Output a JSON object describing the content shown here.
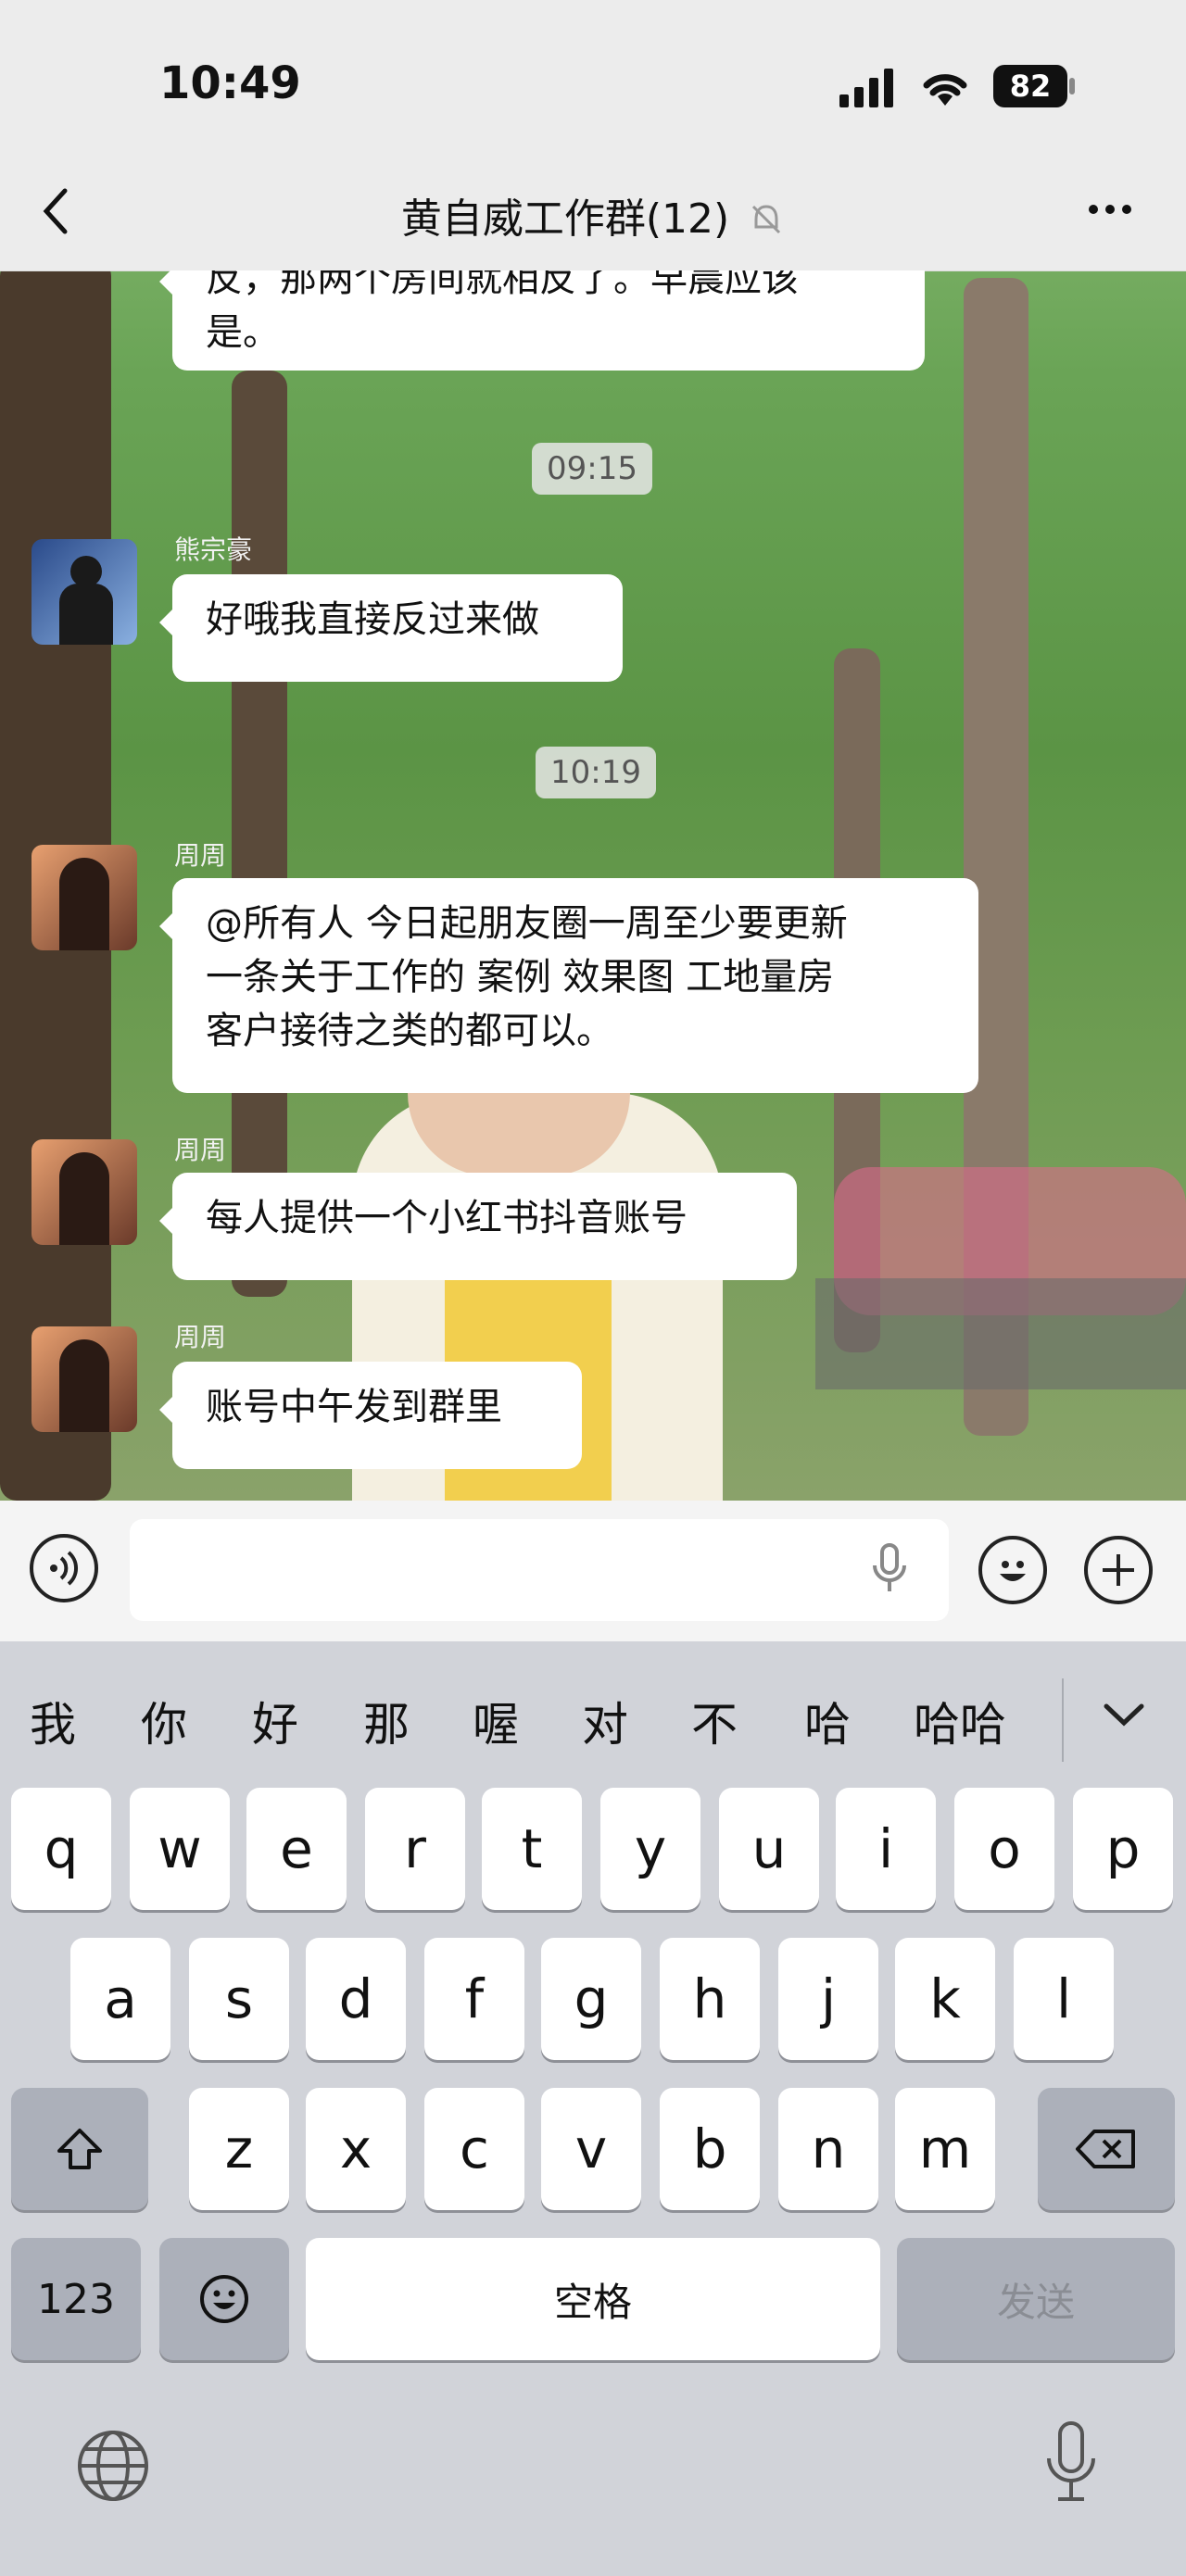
{
  "status": {
    "time": "10:49",
    "battery": "82"
  },
  "nav": {
    "title": "黄自威工作群(12)",
    "back": "back",
    "more": "more"
  },
  "chat": {
    "partial_message": "反，那两个房间就相反了。早晨应该是。",
    "partial_line1": "反，那两个房间就相反了。早晨应该",
    "partial_line2": "是。",
    "time1": "09:15",
    "time2": "10:19",
    "messages": [
      {
        "sender": "熊宗豪",
        "text": "好哦我直接反过来做"
      },
      {
        "sender": "周周",
        "line1": "@所有人 今日起朋友圈一周至少要更新",
        "line2": "一条关于工作的 案例 效果图 工地量房",
        "line3": "客户接待之类的都可以。"
      },
      {
        "sender": "周周",
        "text": "每人提供一个小红书抖音账号"
      },
      {
        "sender": "周周",
        "text": "账号中午发到群里"
      }
    ]
  },
  "input": {
    "value": "",
    "placeholder": ""
  },
  "candidates": [
    "我",
    "你",
    "好",
    "那",
    "喔",
    "对",
    "不",
    "哈",
    "哈哈"
  ],
  "keyboard": {
    "row1": [
      "q",
      "w",
      "e",
      "r",
      "t",
      "y",
      "u",
      "i",
      "o",
      "p"
    ],
    "row2": [
      "a",
      "s",
      "d",
      "f",
      "g",
      "h",
      "j",
      "k",
      "l"
    ],
    "row3": [
      "z",
      "x",
      "c",
      "v",
      "b",
      "n",
      "m"
    ],
    "num_key": "123",
    "space": "空格",
    "send": "发送"
  }
}
